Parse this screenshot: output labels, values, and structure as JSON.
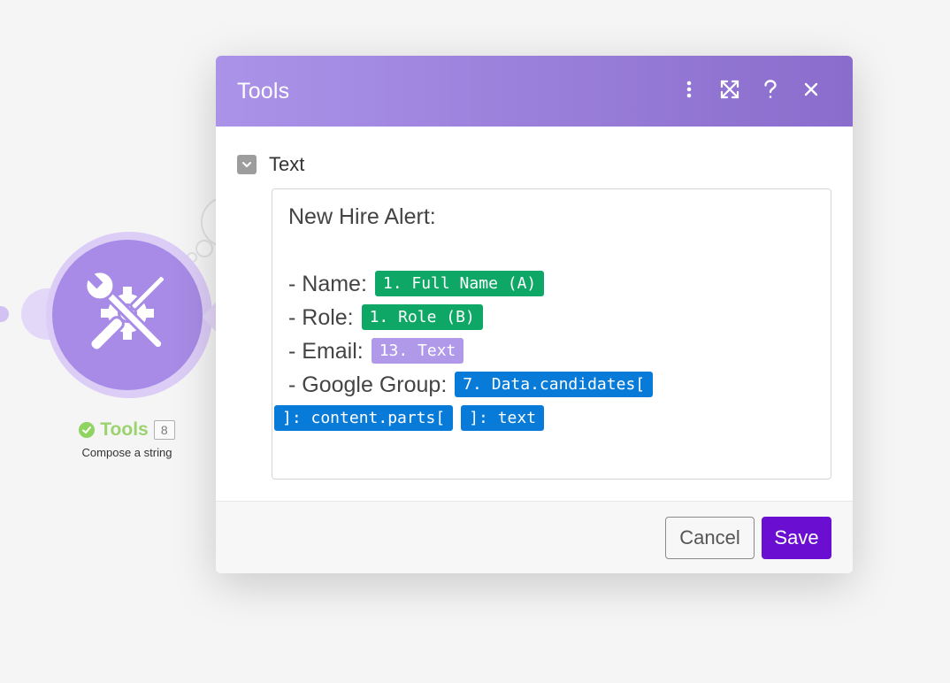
{
  "module_node": {
    "title": "Tools",
    "badge": "8",
    "subtitle": "Compose a string",
    "icon": "tools-icon",
    "status_icon": "check-circle-icon"
  },
  "dialog": {
    "title": "Tools",
    "header_icons": [
      "more-vertical-icon",
      "expand-icon",
      "help-icon",
      "close-icon"
    ],
    "field": {
      "label": "Text",
      "toggle_icon": "chevron-down-icon"
    },
    "editor": {
      "line1": "New Hire Alert:",
      "name_label": "- Name: ",
      "name_pill": "1. Full Name (A)",
      "role_label": "- Role: ",
      "role_pill": "1. Role (B)",
      "email_label": "- Email: ",
      "email_pill": "13. Text",
      "group_label": "- Google Group: ",
      "group_pill_1": "7. Data.candidates[",
      "group_pill_2": "]: content.parts[",
      "group_pill_3": "]: text"
    },
    "footer": {
      "cancel_label": "Cancel",
      "save_label": "Save"
    }
  },
  "colors": {
    "header_gradient_start": "#ab93e9",
    "header_gradient_end": "#8a6ccc",
    "pill_green": "#0fa766",
    "pill_purple": "#b199e9",
    "pill_blue": "#087bd9",
    "save_button": "#6a0fd1"
  }
}
